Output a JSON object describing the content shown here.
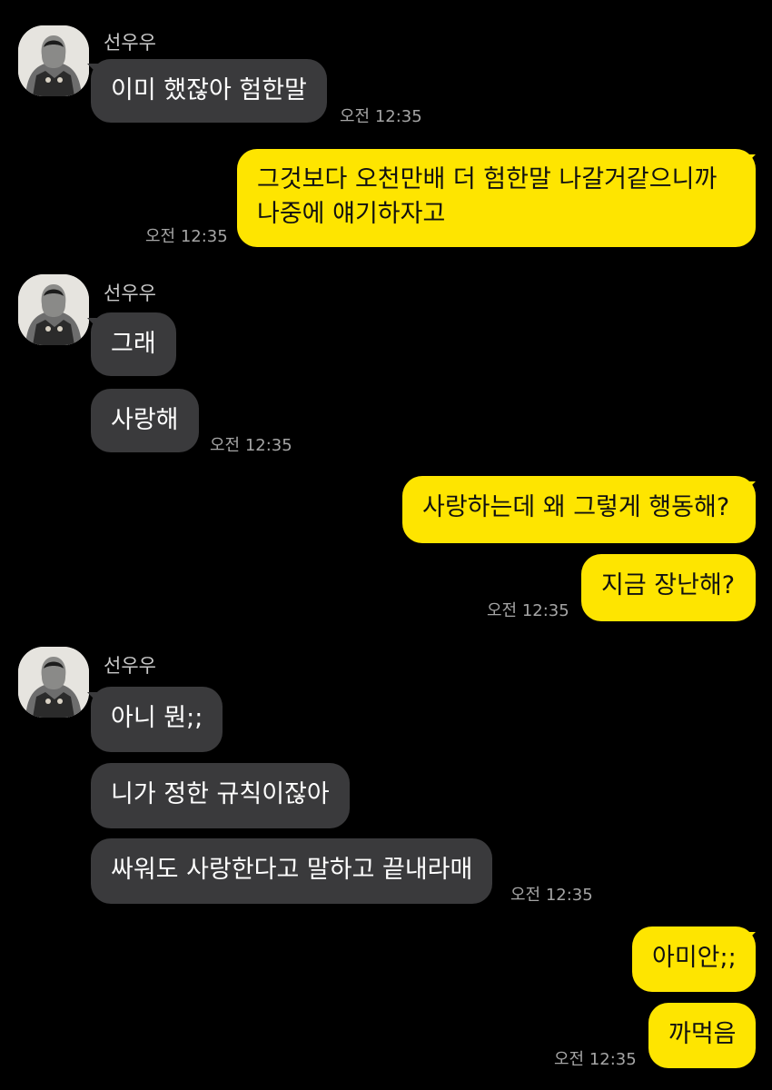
{
  "contact": {
    "name": "선우우"
  },
  "icons": {
    "avatar": "profile-photo-icon"
  },
  "colors": {
    "background": "#000000",
    "incoming_bubble": "#3a3a3c",
    "outgoing_bubble": "#fee500",
    "timestamp": "#a5a5a5"
  },
  "messages": [
    {
      "direction": "in",
      "sender": "선우우",
      "time": "오전 12:35",
      "bubbles": [
        "이미 했잖아 험한말"
      ]
    },
    {
      "direction": "out",
      "time": "오전 12:35",
      "bubbles": [
        "그것보다 오천만배 더 험한말 나갈거같으니까\n나중에 얘기하자고"
      ]
    },
    {
      "direction": "in",
      "sender": "선우우",
      "time": "오전 12:35",
      "bubbles": [
        "그래",
        "사랑해"
      ]
    },
    {
      "direction": "out",
      "time": "오전 12:35",
      "bubbles": [
        "사랑하는데 왜 그렇게 행동해?",
        "지금 장난해?"
      ]
    },
    {
      "direction": "in",
      "sender": "선우우",
      "time": "오전 12:35",
      "bubbles": [
        "아니 뭔;;",
        "니가 정한 규칙이잖아",
        "싸워도 사랑한다고 말하고 끝내라매"
      ]
    },
    {
      "direction": "out",
      "time": "오전 12:35",
      "bubbles": [
        "아미안;;",
        "까먹음"
      ]
    }
  ]
}
